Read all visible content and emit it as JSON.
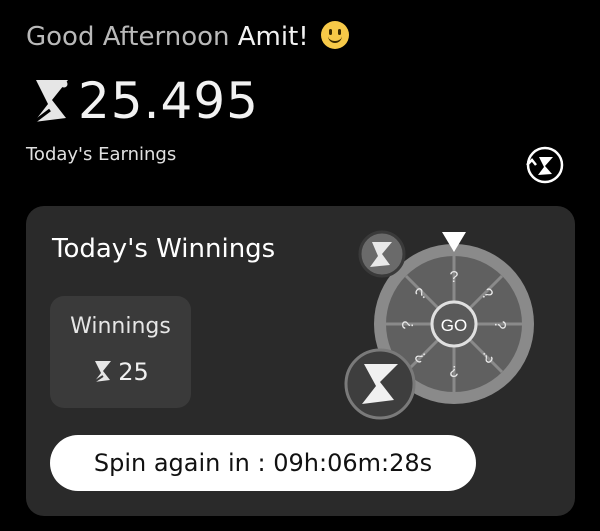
{
  "greeting": {
    "prefix": "Good Afternoon",
    "name": "Amit!",
    "emoji_icon": "smiley-icon"
  },
  "balance": {
    "amount": "25.495",
    "label": "Today's Earnings",
    "currency_icon": "s-coin-icon",
    "history_icon": "history-clock-icon"
  },
  "card": {
    "title": "Today's Winnings",
    "winnings": {
      "label": "Winnings",
      "value": "25"
    },
    "spin": {
      "label": "Spin again in : 09h:06m:28s"
    },
    "wheel": {
      "center_label": "GO",
      "segments": [
        "?",
        "?",
        "?",
        "?",
        "?",
        "?",
        "?",
        "?"
      ]
    }
  },
  "colors": {
    "background": "#000000",
    "card": "#2a2a2a",
    "box": "#3a3a3a",
    "button": "#ffffff"
  }
}
